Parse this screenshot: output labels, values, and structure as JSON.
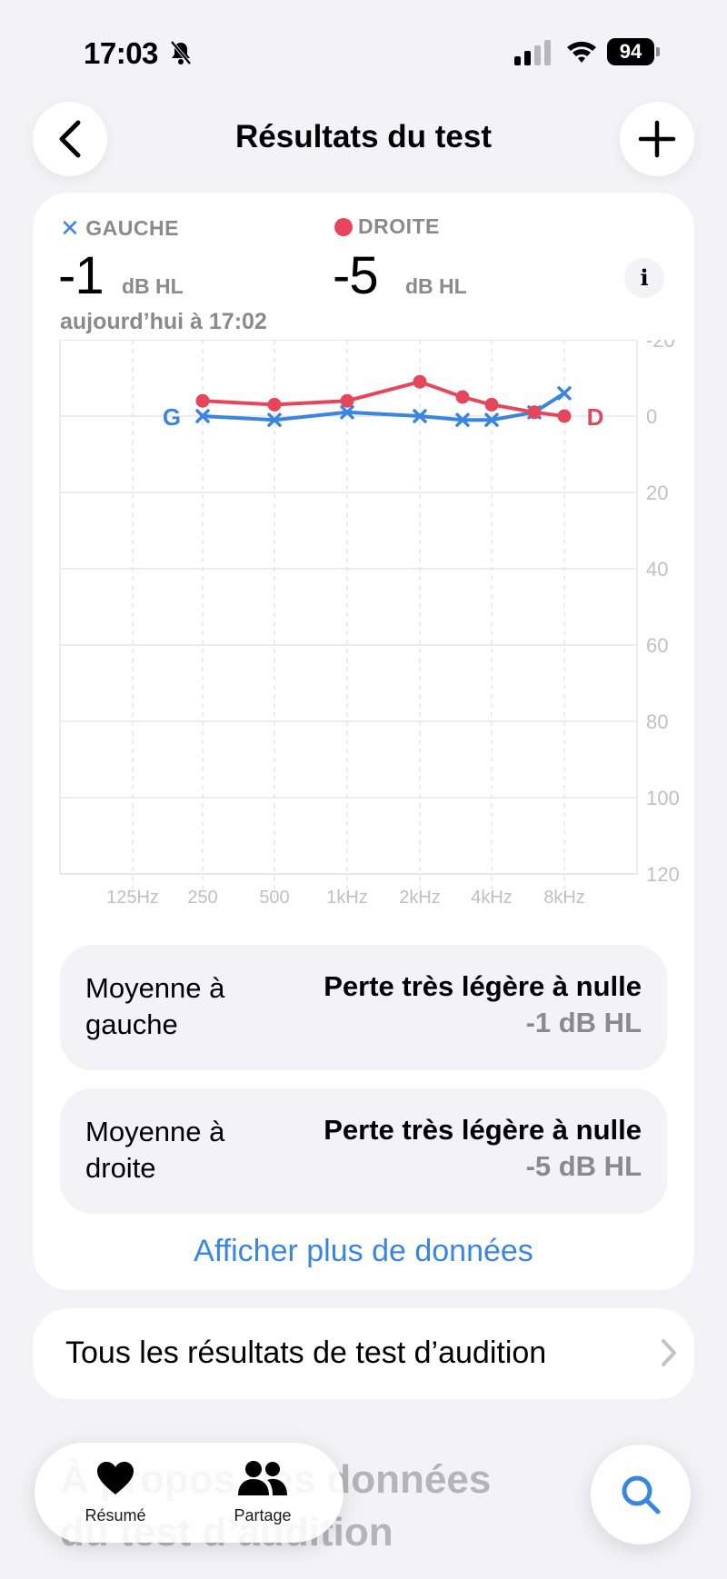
{
  "status_bar": {
    "time": "17:03",
    "battery": "94"
  },
  "nav": {
    "title": "Résultats du test"
  },
  "summary": {
    "left_label": "GAUCHE",
    "right_label": "DROITE",
    "left_value": "-1",
    "right_value": "-5",
    "unit": "dB HL",
    "date": "aujourd’hui à 17:02",
    "info": "i"
  },
  "chart_data": {
    "type": "line",
    "x": [
      "125Hz",
      "250",
      "500",
      "1kHz",
      "2kHz",
      "3kHz",
      "4kHz",
      "6kHz",
      "8kHz"
    ],
    "x_tick_labels": [
      "125Hz",
      "250",
      "500",
      "1kHz",
      "2kHz",
      "4kHz",
      "8kHz"
    ],
    "ylim": [
      -20,
      120
    ],
    "y_inverted": true,
    "y_ticks": [
      "-20",
      "0",
      "20",
      "40",
      "60",
      "80",
      "100",
      "120"
    ],
    "series": [
      {
        "name": "G",
        "marker": "x",
        "color": "#3a85e0",
        "x": [
          "250",
          "500",
          "1kHz",
          "2kHz",
          "3kHz",
          "4kHz",
          "6kHz",
          "8kHz"
        ],
        "values": [
          0,
          1,
          -1,
          0,
          1,
          1,
          -1,
          -6
        ]
      },
      {
        "name": "D",
        "marker": "dot",
        "color": "#e5465c",
        "x": [
          "250",
          "500",
          "1kHz",
          "2kHz",
          "3kHz",
          "4kHz",
          "6kHz",
          "8kHz"
        ],
        "values": [
          -4,
          -3,
          -4,
          -9,
          -5,
          -3,
          -1,
          0
        ]
      }
    ],
    "grid": true
  },
  "averages": [
    {
      "label": "Moyenne à gauche",
      "description": "Perte très légère à nulle",
      "value": "-1 dB HL"
    },
    {
      "label": "Moyenne à droite",
      "description": "Perte très légère à nulle",
      "value": "-5 dB HL"
    }
  ],
  "more_link": "Afficher plus de données",
  "all_results": "Tous les résultats de test d’audition",
  "background_heading": "À propos des données du test d’audition",
  "tabbar": {
    "summary": "Résumé",
    "share": "Partage"
  },
  "colors": {
    "accent": "#3a85e0",
    "left": "#3a85e0",
    "right": "#e5465c"
  }
}
